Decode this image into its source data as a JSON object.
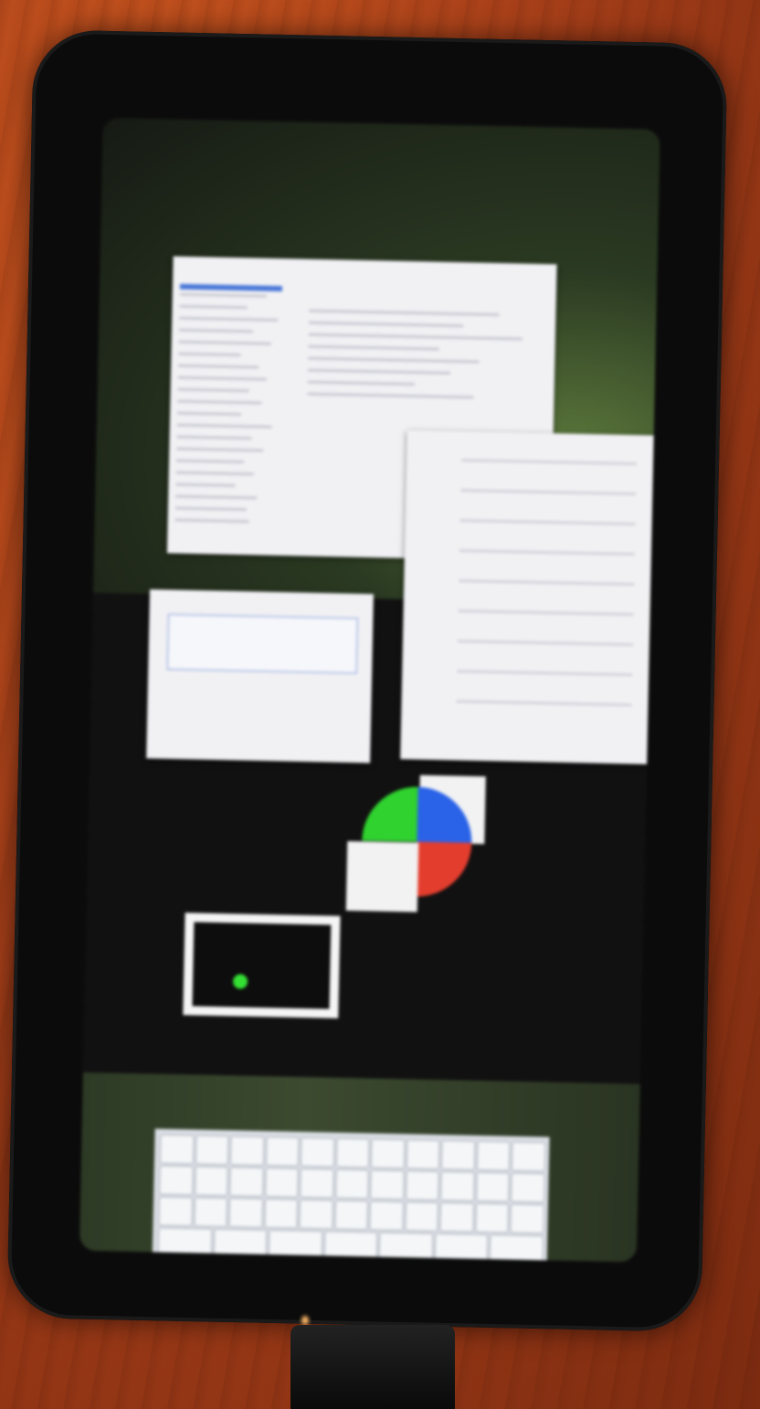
{
  "scene": {
    "subject": "phone",
    "table_color": "#b8461a"
  },
  "screen": {
    "window_main": {
      "selection_color": "#4a78d8"
    },
    "window_login": {
      "tabs_text": "",
      "user_label": "",
      "password_label": ""
    },
    "pie_widget": {
      "colors": [
        "#2fd22f",
        "#2a62e8",
        "#e33d2e"
      ]
    },
    "indicator": {
      "dot_color": "#33e033"
    },
    "keyboard": {
      "rows": [
        [
          "",
          "",
          "",
          "",
          "",
          "",
          "",
          "",
          "",
          "",
          ""
        ],
        [
          "",
          "",
          "",
          "",
          "",
          "",
          "",
          "",
          "",
          "",
          ""
        ],
        [
          "",
          "",
          "",
          "",
          "",
          "",
          "",
          "",
          "",
          "",
          ""
        ],
        [
          "",
          "",
          "",
          "",
          "",
          "",
          ""
        ]
      ]
    }
  }
}
